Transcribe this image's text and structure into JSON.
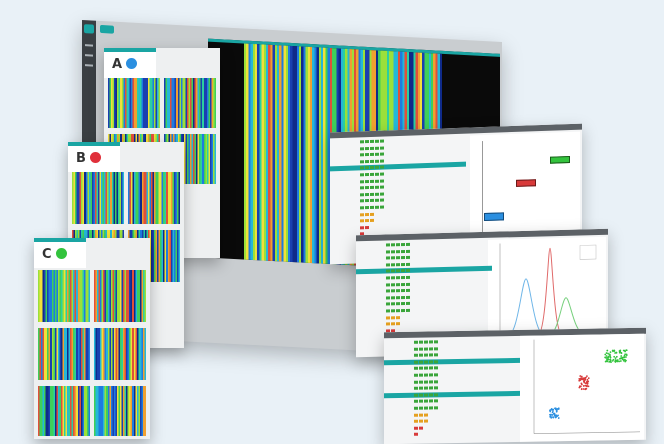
{
  "panels": [
    {
      "label": "A",
      "dot_color": "#2b8fe0"
    },
    {
      "label": "B",
      "dot_color": "#e0303a"
    },
    {
      "label": "C",
      "dot_color": "#33c33d"
    }
  ],
  "colors": {
    "accent": "#1aa5a3",
    "good": "#3aa53a",
    "warn": "#e5a020",
    "bad": "#d83a3a"
  },
  "icons": [
    "app-logo-icon",
    "menu-icon"
  ]
}
